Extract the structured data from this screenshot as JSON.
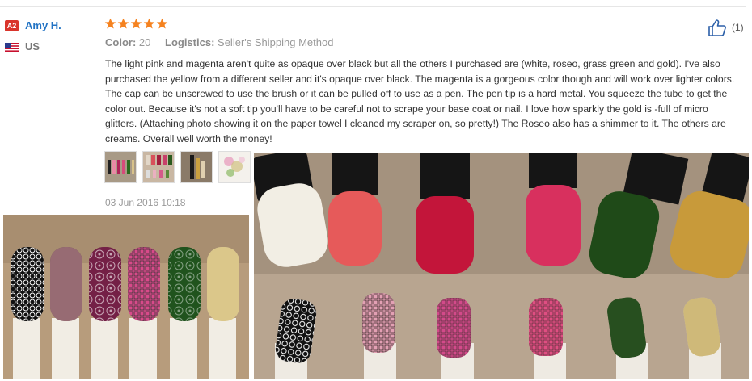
{
  "reviewer": {
    "level_badge": "A2",
    "name": "Amy H.",
    "country": "US"
  },
  "review": {
    "rating_stars": 5,
    "color_label": "Color:",
    "color_value": "20",
    "logistics_label": "Logistics:",
    "logistics_value": "Seller's Shipping Method",
    "text": "The light pink and magenta aren't quite as opaque over black but all the others I purchased are (white, roseo, grass green and gold). I've also purchased the yellow from a different seller and it's opaque over black. The magenta is a gorgeous color though and will work over lighter colors. The cap can be unscrewed to use the brush or it can be pulled off to use as a pen. The pen tip is a hard metal. You squeeze the tube to get the color out. Because it's not a soft tip you'll have to be careful not to scrape your base coat or nail. I love how sparkly the gold is -full of micro glitters. (Attaching photo showing it on the paper towel I cleaned my scraper on, so pretty!) The Roseo also has a shimmer to it. The others are creams. Overall well worth the money!",
    "date": "03 Jun 2016 10:18",
    "helpful_count": "(1)"
  },
  "thumbnails": [
    {
      "name": "photo-thumbnail-1"
    },
    {
      "name": "photo-thumbnail-2"
    },
    {
      "name": "photo-thumbnail-3"
    },
    {
      "name": "photo-thumbnail-4"
    }
  ],
  "colors": {
    "link_blue": "#2273c4",
    "star_orange": "#f5821f",
    "badge_red": "#d9342b",
    "muted_gray": "#999999"
  },
  "icons": {
    "like": "thumbs-up-icon",
    "flag": "us-flag-icon",
    "star": "star-icon"
  }
}
